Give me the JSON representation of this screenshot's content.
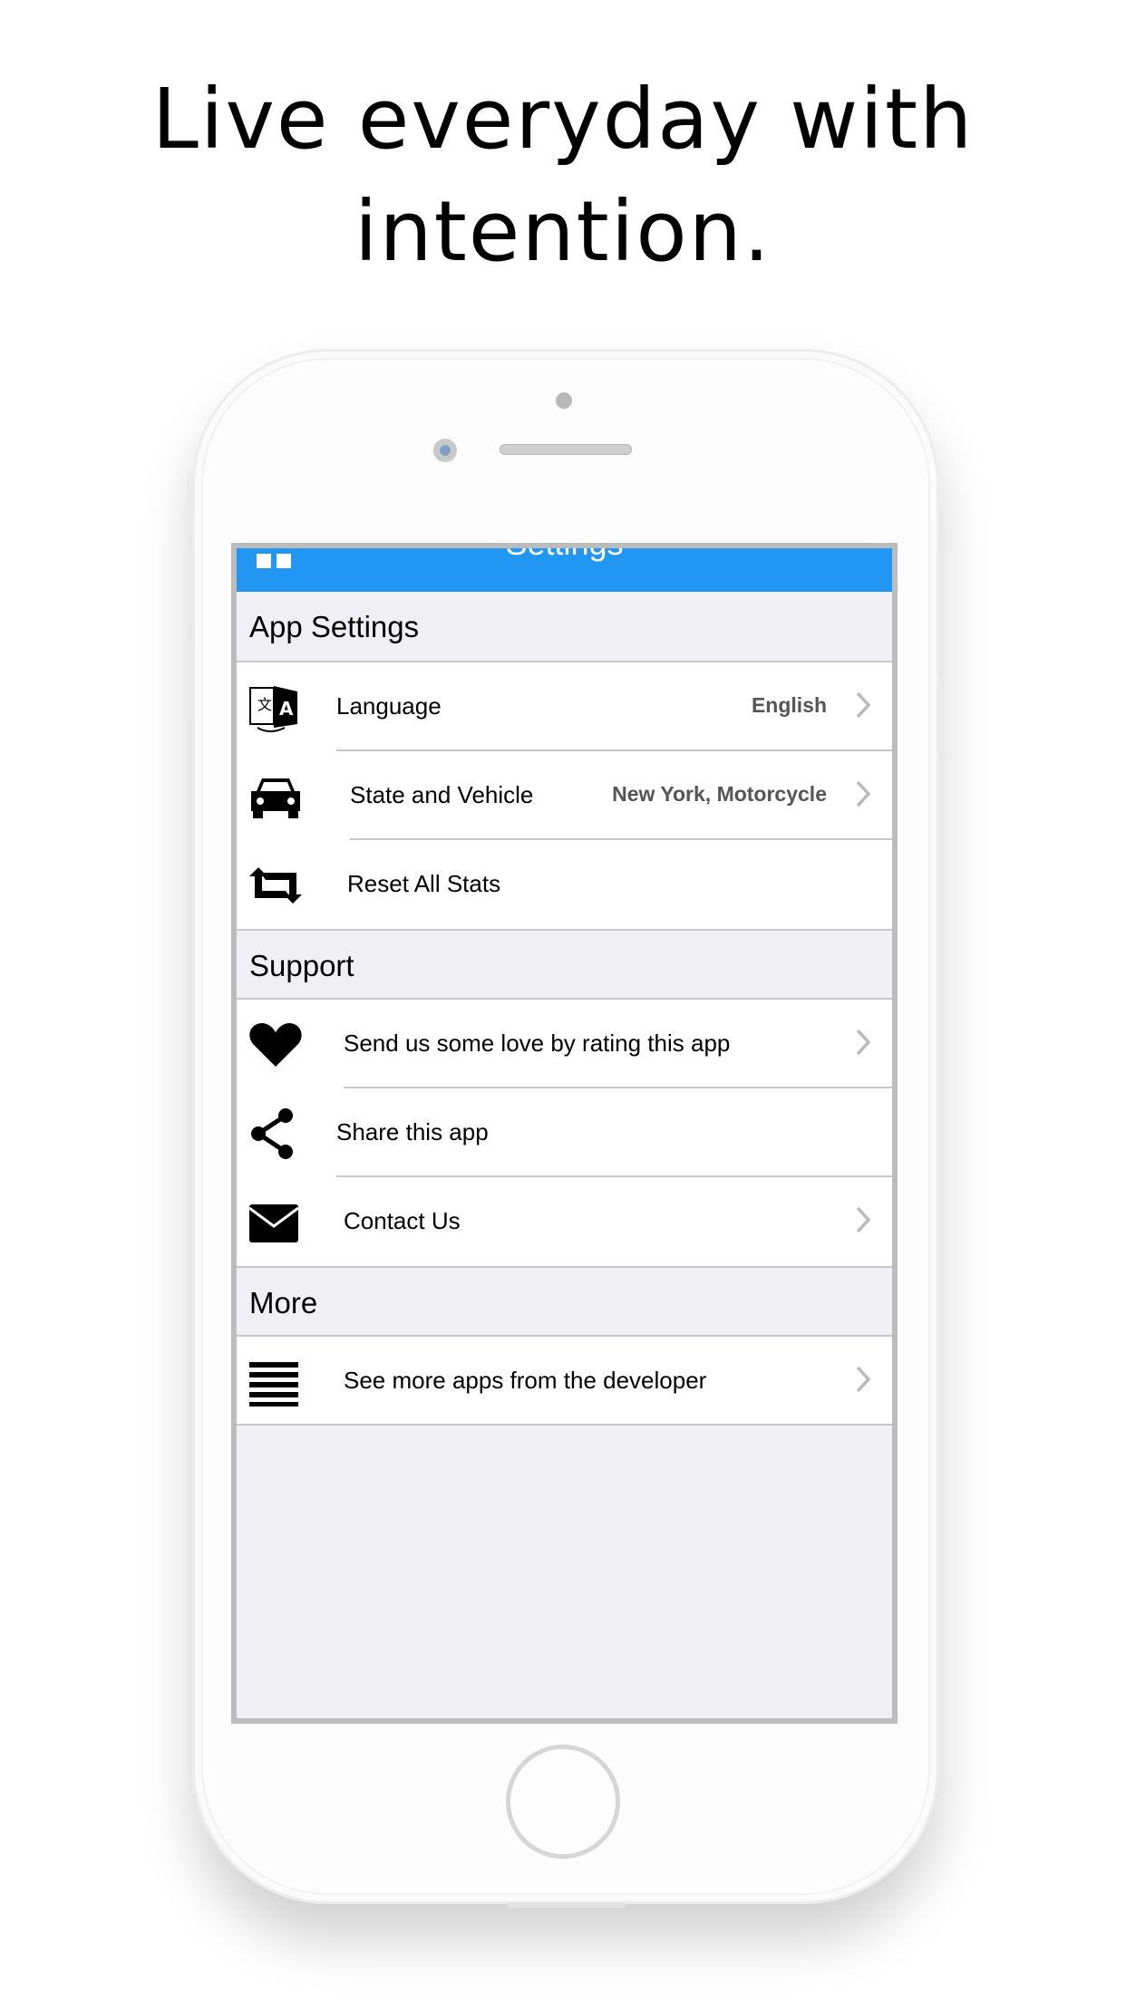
{
  "headline": {
    "line1": "Live everyday with",
    "line2": "intention."
  },
  "navbar": {
    "title": "Settings",
    "icon": "grid-icon",
    "color": "#2196f3"
  },
  "sections": [
    {
      "header": "App Settings",
      "rows": [
        {
          "label": "Language",
          "value": "English",
          "icon": "translate-icon",
          "chevron": true
        },
        {
          "label": "State and Vehicle",
          "value": "New York, Motorcycle",
          "icon": "car-icon",
          "chevron": true
        },
        {
          "label": "Reset All Stats",
          "value": "",
          "icon": "repeat-icon",
          "chevron": false
        }
      ]
    },
    {
      "header": "Support",
      "rows": [
        {
          "label": "Send us some love by rating this app",
          "icon": "heart-icon",
          "chevron": true
        },
        {
          "label": "Share this app",
          "icon": "share-icon",
          "chevron": false
        },
        {
          "label": "Contact Us",
          "icon": "envelope-icon",
          "chevron": true
        }
      ]
    },
    {
      "header": "More",
      "rows": [
        {
          "label": "See more apps from the developer",
          "icon": "list-icon",
          "chevron": true
        }
      ]
    }
  ]
}
